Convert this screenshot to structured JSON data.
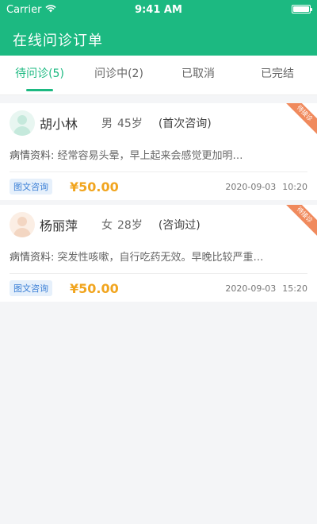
{
  "status_bar": {
    "carrier": "Carrier",
    "time": "9:41 AM"
  },
  "header": {
    "title": "在线问诊订单"
  },
  "tabs": [
    {
      "label": "待问诊(5)",
      "active": true
    },
    {
      "label": "问诊中(2)",
      "active": false
    },
    {
      "label": "已取消",
      "active": false
    },
    {
      "label": "已完结",
      "active": false
    }
  ],
  "orders": [
    {
      "ribbon": "待接诊",
      "name": "胡小林",
      "gender": "男",
      "age": "45岁",
      "visit_type": "(首次咨询)",
      "desc_label": "病情资料:",
      "desc_text": "经常容易头晕，早上起来会感觉更加明…",
      "consult_type": "图文咨询",
      "price": "¥50.00",
      "date": "2020-09-03",
      "clock": "10:20"
    },
    {
      "ribbon": "待接诊",
      "name": "杨丽萍",
      "gender": "女",
      "age": "28岁",
      "visit_type": "(咨询过)",
      "desc_label": "病情资料:",
      "desc_text": "突发性咳嗽，自行吃药无效。早晚比较严重…",
      "consult_type": "图文咨询",
      "price": "¥50.00",
      "date": "2020-09-03",
      "clock": "15:20"
    }
  ],
  "colors": {
    "brand": "#1cb981",
    "price": "#f1a51f",
    "ribbon": "#f08a5d"
  }
}
